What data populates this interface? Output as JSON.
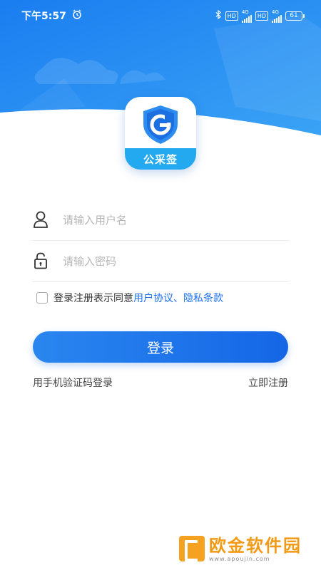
{
  "status_bar": {
    "time": "下午5:57",
    "hd_1": "HD",
    "network_1": "4G",
    "hd_2": "HD",
    "network_2": "4G",
    "battery": "61"
  },
  "app": {
    "logo_text": "公采签",
    "brand_color": "#1a6ff0"
  },
  "form": {
    "username_placeholder": "请输入用户名",
    "password_placeholder": "请输入密码",
    "agree_prefix": "登录注册表示同意",
    "agree_link": "用户协议、隐私条款",
    "login_button": "登录",
    "sms_login": "用手机验证码登录",
    "register": "立即注册"
  },
  "watermark": {
    "title": "欧金软件园",
    "subtitle": "www.apoujin.com"
  }
}
